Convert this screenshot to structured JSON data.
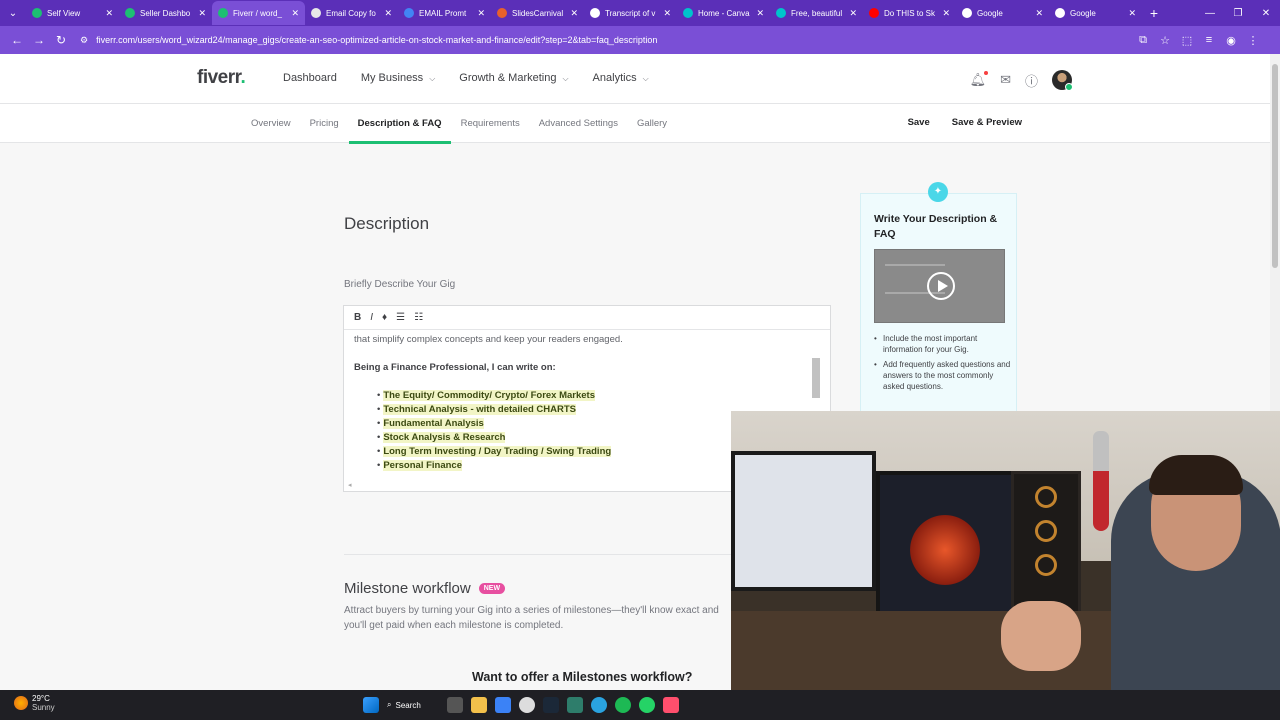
{
  "browser": {
    "tabs": [
      {
        "label": "Self View",
        "color": "#1dbf73",
        "active": false
      },
      {
        "label": "Seller Dashbo",
        "color": "#1dbf73",
        "active": false
      },
      {
        "label": "Fiverr / word_",
        "color": "#1dbf73",
        "active": true
      },
      {
        "label": "Email Copy fo",
        "color": "#e8e8e8",
        "active": false
      },
      {
        "label": "EMAIL Promt",
        "color": "#4285f4",
        "active": false
      },
      {
        "label": "SlidesCarnival",
        "color": "#e8612c",
        "active": false
      },
      {
        "label": "Transcript of v",
        "color": "#ffffff",
        "active": false
      },
      {
        "label": "Home - Canva",
        "color": "#00c4cc",
        "active": false
      },
      {
        "label": "Free, beautiful",
        "color": "#00c4cc",
        "active": false
      },
      {
        "label": "Do THIS to Sk",
        "color": "#ff0000",
        "active": false
      },
      {
        "label": "Google",
        "color": "#ffffff",
        "active": false
      },
      {
        "label": "Google",
        "color": "#ffffff",
        "active": false
      }
    ],
    "url": "fiverr.com/users/word_wizard24/manage_gigs/create-an-seo-optimized-article-on-stock-market-and-finance/edit?step=2&tab=faq_description"
  },
  "header": {
    "logo": "fiverr",
    "logo_dot": ".",
    "nav": [
      "Dashboard",
      "My Business",
      "Growth & Marketing",
      "Analytics"
    ]
  },
  "steps": [
    "Overview",
    "Pricing",
    "Description & FAQ",
    "Requirements",
    "Advanced Settings",
    "Gallery"
  ],
  "actions": {
    "save": "Save",
    "save_preview": "Save & Preview"
  },
  "description": {
    "title": "Description",
    "label": "Briefly Describe Your Gig",
    "intro_line": "that simplify complex concepts and keep your readers engaged.",
    "subheading": "Being a Finance Professional, I can write on:",
    "bullets": [
      "The Equity/ Commodity/ Crypto/ Forex Markets",
      "Technical Analysis - with detailed CHARTS",
      "Fundamental Analysis",
      "Stock Analysis & Research",
      "Long Term Investing / Day Trading / Swing Trading",
      "Personal Finance"
    ]
  },
  "milestone": {
    "title": "Milestone workflow",
    "badge": "NEW",
    "desc": "Attract buyers by turning your Gig into a series of milestones—they'll know exact and you'll get paid when each milestone is completed.",
    "question": "Want to offer a Milestones workflow?"
  },
  "tip": {
    "title": "Write Your Description & FAQ",
    "items": [
      "Include the most important information for your Gig.",
      "Add frequently asked questions and answers to the most commonly asked questions."
    ]
  },
  "taskbar": {
    "temp": "29°C",
    "condition": "Sunny",
    "search": "Search"
  }
}
